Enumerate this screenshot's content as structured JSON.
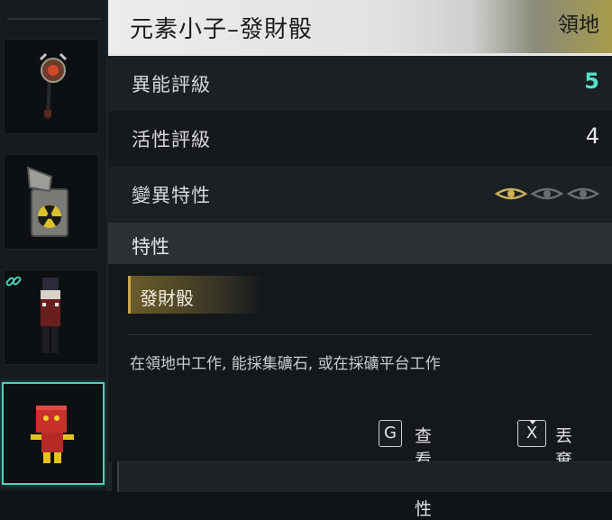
{
  "item": {
    "name": "元素小子–發財骰",
    "territory_label": "領地"
  },
  "stats": [
    {
      "label": "異能評級",
      "value": "5"
    },
    {
      "label": "活性評級",
      "value": "4"
    },
    {
      "label": "變異特性",
      "eyes_active": 1,
      "eyes_total": 3
    }
  ],
  "traits": {
    "heading": "特性",
    "items": [
      {
        "label": "發財骰"
      }
    ],
    "description": "在領地中工作, 能採集礦石, 或在採礦平台工作"
  },
  "actions": [
    {
      "key": "G",
      "label": "查看特性"
    },
    {
      "key": "X",
      "label": "丟棄"
    }
  ],
  "inventory": {
    "slots": [
      {
        "icon": "round-lantern-icon"
      },
      {
        "icon": "radiation-lighter-icon"
      },
      {
        "icon": "nutcracker-figure-icon",
        "linked": true
      },
      {
        "icon": "red-box-robot-icon",
        "selected": true
      }
    ]
  },
  "colors": {
    "accent": "#4fe3c5",
    "selection": "#4fd1b8",
    "trait_gold": "#c6a64a"
  }
}
